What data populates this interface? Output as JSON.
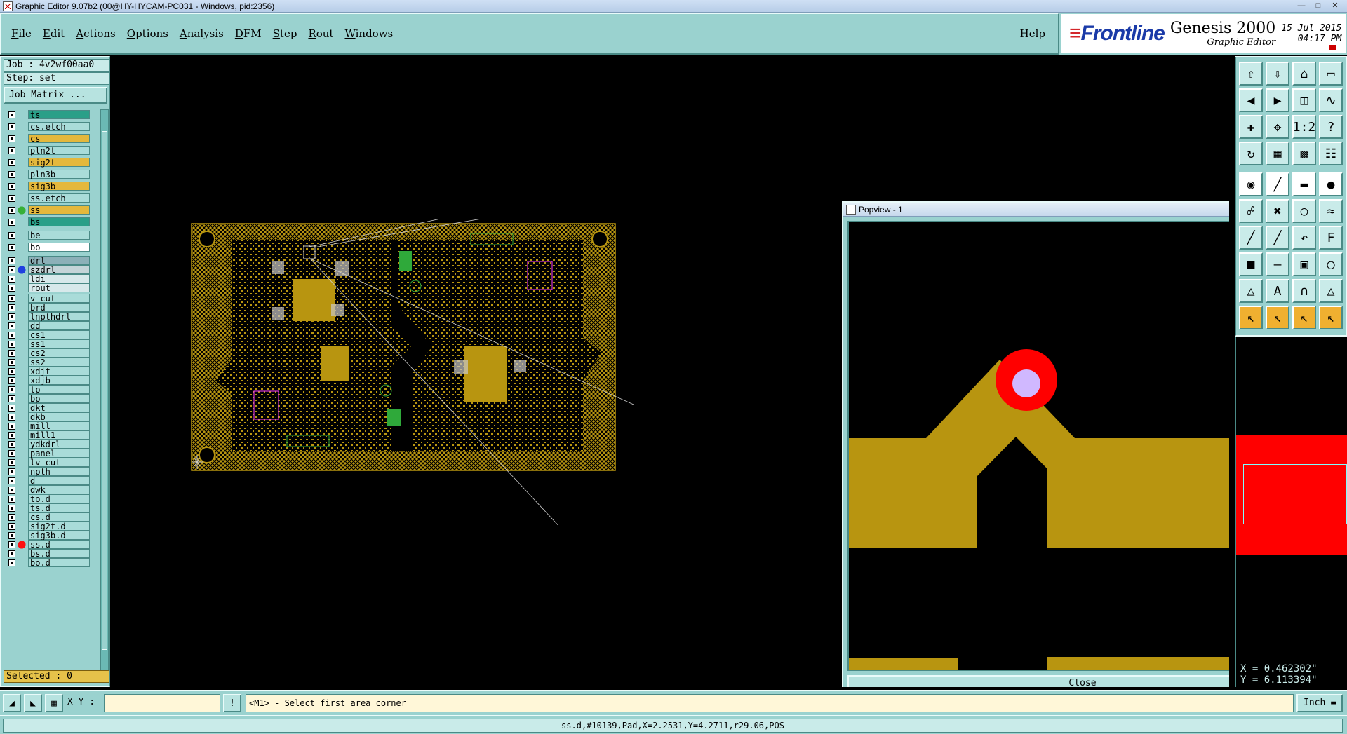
{
  "window": {
    "title": "Graphic Editor 9.07b2 (00@HY-HYCAM-PC031 - Windows, pid:2356)"
  },
  "menu": {
    "items": [
      {
        "label": "File",
        "key": "F",
        "rest": "ile"
      },
      {
        "label": "Edit",
        "key": "E",
        "rest": "dit"
      },
      {
        "label": "Actions",
        "key": "A",
        "rest": "ctions"
      },
      {
        "label": "Options",
        "key": "O",
        "rest": "ptions"
      },
      {
        "label": "Analysis",
        "key": "A",
        "rest": "nalysis"
      },
      {
        "label": "DFM",
        "key": "D",
        "rest": "FM"
      },
      {
        "label": "Step",
        "key": "S",
        "rest": "tep"
      },
      {
        "label": "Rout",
        "key": "R",
        "rest": "out"
      },
      {
        "label": "Windows",
        "key": "W",
        "rest": "indows"
      }
    ],
    "help": "Help"
  },
  "brand": {
    "logo": "Frontline",
    "product": "Genesis 2000",
    "subtitle": "Graphic Editor",
    "date": "15 Jul 2015",
    "time": "04:17 PM"
  },
  "job": {
    "job_line": "Job : 4v2wf00aa0",
    "step_line": "Step: set",
    "matrix_button": "Job Matrix ..."
  },
  "layers": [
    {
      "name": "ts",
      "style": "sig"
    },
    {
      "name": "cs.etch",
      "style": ""
    },
    {
      "name": "cs",
      "style": "cop"
    },
    {
      "name": "pln2t",
      "style": ""
    },
    {
      "name": "sig2t",
      "style": "cop"
    },
    {
      "name": "pln3b",
      "style": ""
    },
    {
      "name": "sig3b",
      "style": "cop"
    },
    {
      "name": "ss.etch",
      "style": ""
    },
    {
      "name": "ss",
      "style": "cop",
      "marker": "green"
    },
    {
      "name": "bs",
      "style": "sig"
    },
    {
      "name": "be",
      "style": ""
    },
    {
      "name": "bo",
      "style": "white"
    },
    {
      "name": "drl",
      "style": "drill"
    },
    {
      "name": "szdrl",
      "style": "gray",
      "marker": "blue"
    },
    {
      "name": "ldi",
      "style": "ldi"
    },
    {
      "name": "rout",
      "style": "ldi"
    },
    {
      "name": "v-cut",
      "style": ""
    },
    {
      "name": "brd",
      "style": ""
    },
    {
      "name": "lnpthdrl",
      "style": ""
    },
    {
      "name": "dd",
      "style": ""
    },
    {
      "name": "cs1",
      "style": ""
    },
    {
      "name": "ss1",
      "style": ""
    },
    {
      "name": "cs2",
      "style": ""
    },
    {
      "name": "ss2",
      "style": ""
    },
    {
      "name": "xdjt",
      "style": ""
    },
    {
      "name": "xdjb",
      "style": ""
    },
    {
      "name": "tp",
      "style": ""
    },
    {
      "name": "bp",
      "style": ""
    },
    {
      "name": "dkt",
      "style": ""
    },
    {
      "name": "dkb",
      "style": ""
    },
    {
      "name": "mill",
      "style": ""
    },
    {
      "name": "mill1",
      "style": ""
    },
    {
      "name": "ydkdrl",
      "style": ""
    },
    {
      "name": "panel",
      "style": ""
    },
    {
      "name": "lv-cut",
      "style": ""
    },
    {
      "name": "npth",
      "style": ""
    },
    {
      "name": "d",
      "style": ""
    },
    {
      "name": "dwk",
      "style": ""
    },
    {
      "name": "to.d",
      "style": ""
    },
    {
      "name": "ts.d",
      "style": ""
    },
    {
      "name": "cs.d",
      "style": ""
    },
    {
      "name": "sig2t.d",
      "style": ""
    },
    {
      "name": "sig3b.d",
      "style": ""
    },
    {
      "name": "ss.d",
      "style": "",
      "marker": "red"
    },
    {
      "name": "bs.d",
      "style": ""
    },
    {
      "name": "bo.d",
      "style": ""
    }
  ],
  "selected": "Selected : 0",
  "popview": {
    "title": "Popview - 1",
    "close_label": "Close"
  },
  "coords": {
    "x": "X = 0.462302\"",
    "y": "Y = 6.113394\""
  },
  "cmd": {
    "xy_label": "X Y :",
    "xy_value": "",
    "message": "<M1> - Select first area corner",
    "unit": "Inch"
  },
  "status": {
    "text": "ss.d,#10139,Pad,X=2.2531,Y=4.2711,r29.06,POS"
  },
  "colors": {
    "copper": "#b89510",
    "panel": "#9ad2cf",
    "highlight": "#ff0000"
  }
}
